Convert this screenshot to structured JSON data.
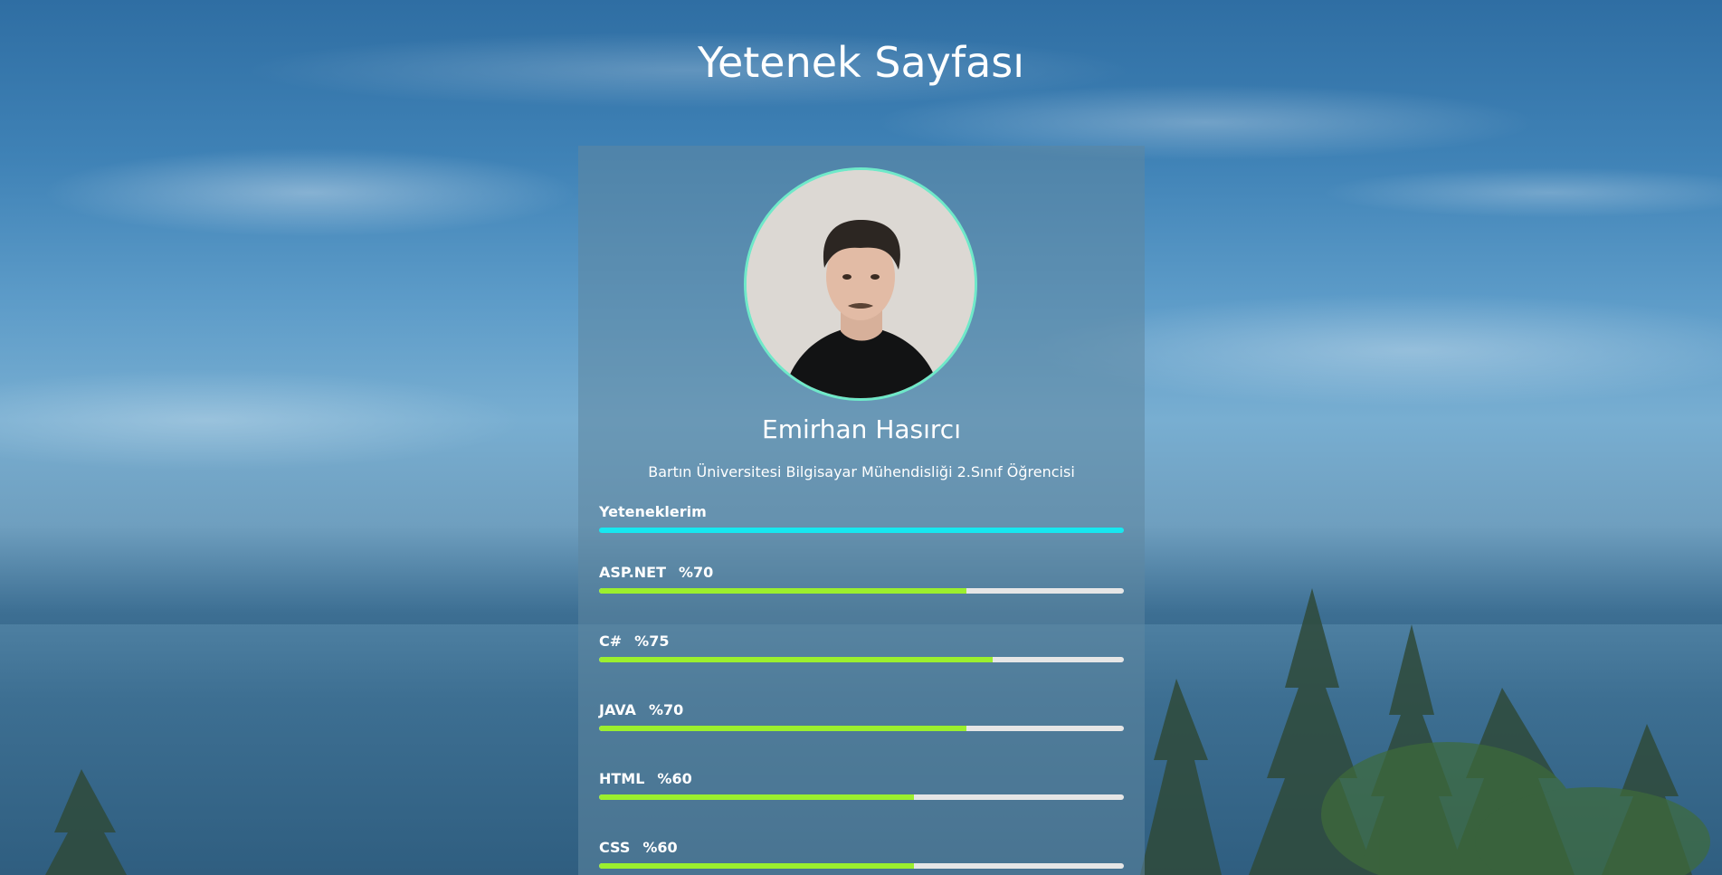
{
  "header": {
    "title": "Yetenek Sayfası"
  },
  "profile": {
    "name": "Emirhan Hasırcı",
    "description": "Bartın Üniversitesi Bilgisayar Mühendisliği 2.Sınıf Öğrencisi"
  },
  "skills": {
    "heading": "Yeteneklerim",
    "items": [
      {
        "name": "ASP.NET",
        "percent_label": "%70",
        "level": 70
      },
      {
        "name": "C#",
        "percent_label": "%75",
        "level": 75
      },
      {
        "name": "JAVA",
        "percent_label": "%70",
        "level": 70
      },
      {
        "name": "HTML",
        "percent_label": "%60",
        "level": 60
      },
      {
        "name": "CSS",
        "percent_label": "%60",
        "level": 60
      }
    ]
  },
  "colors": {
    "heading_bar": "#17e8f0",
    "skill_fill": "#9bef2e",
    "skill_track": "#e6e6e6",
    "avatar_border": "#6fe9c9"
  }
}
